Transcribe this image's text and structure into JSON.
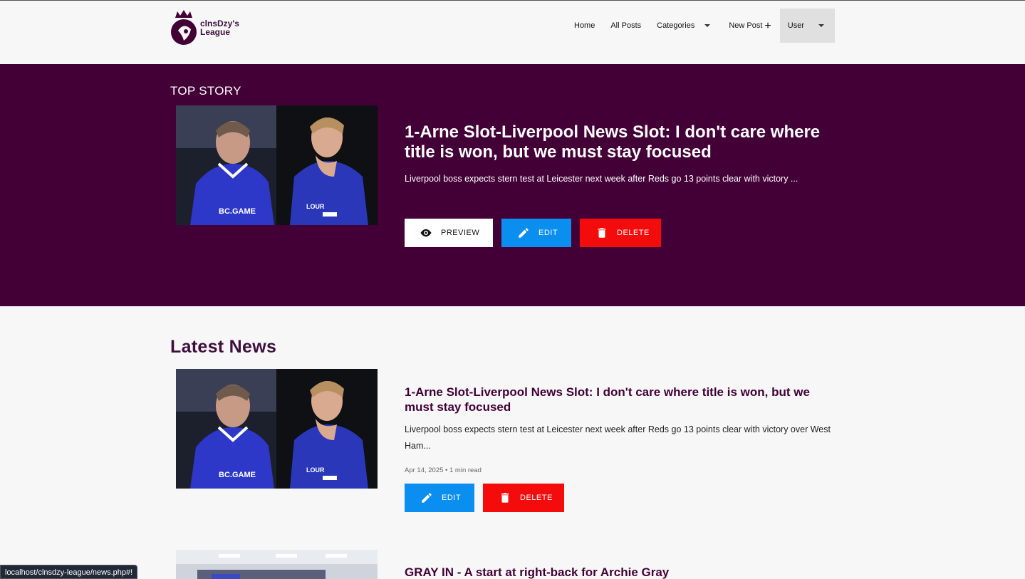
{
  "brand": {
    "name_line1": "clnsDzy's",
    "name_line2": "League",
    "color": "#430037"
  },
  "nav": {
    "home": "Home",
    "all_posts": "All Posts",
    "categories": "Categories",
    "new_post": "New Post",
    "new_post_icon": "+",
    "user": "User"
  },
  "top_story": {
    "section_label": "TOP STORY",
    "title": "1-Arne Slot-Liverpool News Slot: I don't care where title is won, but we must stay focused",
    "excerpt": "Liverpool boss expects stern test at Leicester next week after Reds go 13 points clear with victory ...",
    "buttons": {
      "preview": "PREVIEW",
      "edit": "EDIT",
      "delete": "DELETE"
    }
  },
  "latest": {
    "section_title": "Latest News",
    "articles": [
      {
        "title": "1-Arne Slot-Liverpool News Slot: I don't care where title is won, but we must stay focused",
        "excerpt": "Liverpool boss expects stern test at Leicester next week after Reds go 13 points clear with victory over West Ham...",
        "meta": "Apr 14, 2025 • 1 min read",
        "edit": "EDIT",
        "delete": "DELETE"
      },
      {
        "title": "GRAY IN - A start at right-back for Archie Gray"
      }
    ]
  },
  "image_jersey": {
    "left": "BC.GAME",
    "right": "LOUR"
  },
  "status_bar": "localhost/clnsdzy-league/news.php#!",
  "colors": {
    "edit": "#0a8ef0",
    "delete": "#f40c0c",
    "preview_bg": "#ffffff",
    "top_story_bg": "#430037"
  }
}
